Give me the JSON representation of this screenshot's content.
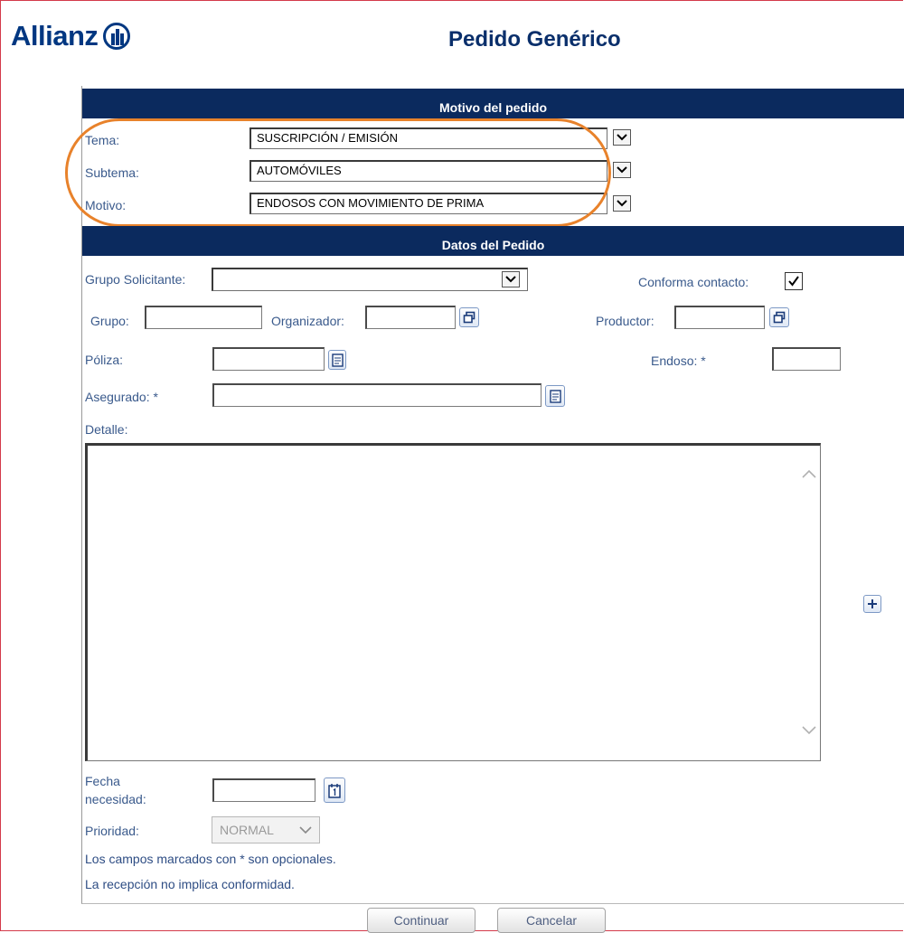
{
  "brand": {
    "name": "Allianz"
  },
  "page": {
    "title": "Pedido Genérico"
  },
  "motivo": {
    "header": "Motivo del pedido",
    "tema": {
      "label": "Tema:",
      "value": "SUSCRIPCIÓN / EMISIÓN"
    },
    "subtema": {
      "label": "Subtema:",
      "value": "AUTOMÓVILES"
    },
    "motivo": {
      "label": "Motivo:",
      "value": "ENDOSOS CON MOVIMIENTO DE PRIMA"
    }
  },
  "datos": {
    "header": "Datos del Pedido",
    "grupo_solicitante": {
      "label": "Grupo Solicitante:",
      "value": ""
    },
    "conforma_contacto": {
      "label": "Conforma contacto:",
      "checked": true
    },
    "grupo": {
      "label": "Grupo:",
      "value": ""
    },
    "organizador": {
      "label": "Organizador:",
      "value": ""
    },
    "productor": {
      "label": "Productor:",
      "value": ""
    },
    "poliza": {
      "label": "Póliza:",
      "value": ""
    },
    "endoso": {
      "label": "Endoso: *",
      "value": ""
    },
    "asegurado": {
      "label": "Asegurado: *",
      "value": ""
    },
    "detalle": {
      "label": "Detalle:",
      "value": ""
    },
    "fecha_necesidad": {
      "label_line1": "Fecha",
      "label_line2": "necesidad:",
      "value": ""
    },
    "prioridad": {
      "label": "Prioridad:",
      "value": "NORMAL"
    },
    "notes": [
      "Los campos marcados con * son opcionales.",
      "La recepción no implica conformidad."
    ]
  },
  "actions": {
    "continuar": "Continuar",
    "cancelar": "Cancelar"
  },
  "colors": {
    "brand": "#003781",
    "header_bg": "#0b2a5e",
    "highlight_oval": "#e8822b",
    "frame": "#d43a4a"
  },
  "icons": [
    "allianz-logo-icon",
    "dropdown-arrow-icon",
    "lookup-window-icon",
    "document-search-icon",
    "calendar-icon",
    "plus-icon",
    "checkmark-icon",
    "scroll-up-icon",
    "scroll-down-icon"
  ]
}
